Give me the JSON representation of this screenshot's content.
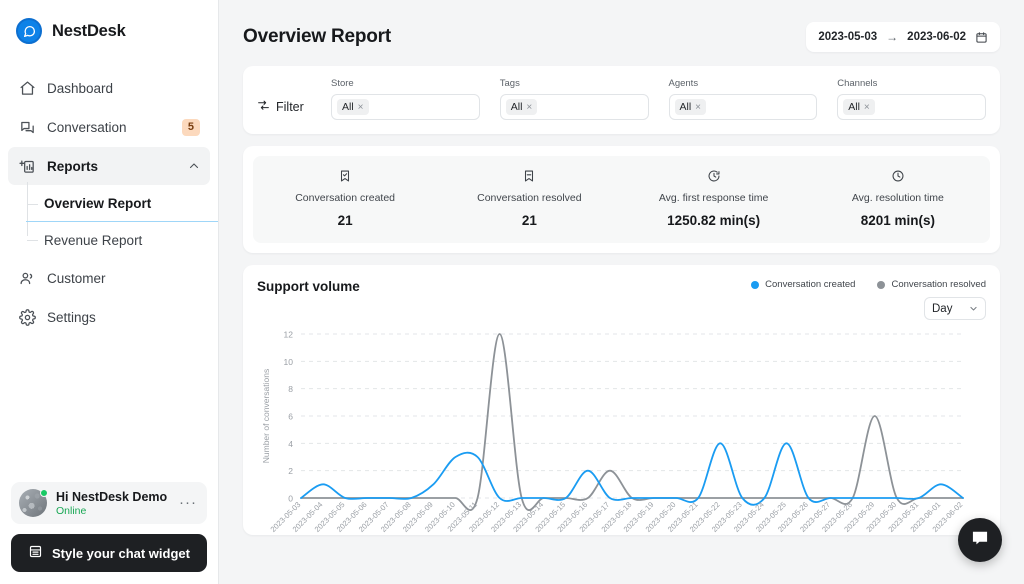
{
  "sidebar": {
    "brand": {
      "name": "NestDesk",
      "logo_icon": "chat-bubble-icon"
    },
    "items": [
      {
        "label": "Dashboard",
        "icon": "home-icon"
      },
      {
        "label": "Conversation",
        "icon": "conversation-icon",
        "badge": "5"
      },
      {
        "label": "Reports",
        "icon": "reports-icon",
        "active": true,
        "chevron": "chevron-up-icon"
      },
      {
        "label": "Customer",
        "icon": "customer-icon"
      },
      {
        "label": "Settings",
        "icon": "gear-icon"
      }
    ],
    "subitems": [
      {
        "label": "Overview Report",
        "selected": true
      },
      {
        "label": "Revenue Report",
        "selected": false
      }
    ],
    "user": {
      "name": "Hi NestDesk Demo",
      "status": "Online",
      "more": "···"
    },
    "widget_button": {
      "label": "Style your chat widget",
      "icon": "layout-icon"
    }
  },
  "header": {
    "title": "Overview Report",
    "date_range": {
      "start": "2023-05-03",
      "arrow": "→",
      "end": "2023-06-02",
      "icon": "calendar-icon"
    }
  },
  "filter": {
    "label": "Filter",
    "icon": "filter-icon",
    "fields": [
      {
        "caption": "Store",
        "value": "All",
        "remove": "×"
      },
      {
        "caption": "Tags",
        "value": "All",
        "remove": "×"
      },
      {
        "caption": "Agents",
        "value": "All",
        "remove": "×"
      },
      {
        "caption": "Channels",
        "value": "All",
        "remove": "×"
      }
    ]
  },
  "stats": [
    {
      "icon": "bookmark-check-icon",
      "label": "Conversation created",
      "value": "21"
    },
    {
      "icon": "bookmark-icon",
      "label": "Conversation resolved",
      "value": "21"
    },
    {
      "icon": "clock-arrow-icon",
      "label": "Avg. first response time",
      "value": "1250.82 min(s)"
    },
    {
      "icon": "clock-icon",
      "label": "Avg. resolution time",
      "value": "8201 min(s)"
    }
  ],
  "chart_panel": {
    "title": "Support volume",
    "granularity": {
      "value": "Day",
      "icon": "chevron-down-icon"
    }
  },
  "colors": {
    "created": "#1a9cf2",
    "resolved": "#8d9297",
    "accent": "#0d82e8",
    "badge_bg": "#fcd9bd",
    "online": "#18a754"
  },
  "chart_data": {
    "type": "line",
    "title": "Support volume",
    "xlabel": "",
    "ylabel": "Number of conversations",
    "ylim": [
      0,
      12
    ],
    "yticks": [
      0,
      2,
      4,
      6,
      8,
      10,
      12
    ],
    "grid": true,
    "legend_position": "top-right",
    "x": [
      "2023-05-03",
      "2023-05-04",
      "2023-05-05",
      "2023-05-06",
      "2023-05-07",
      "2023-05-08",
      "2023-05-09",
      "2023-05-10",
      "2023-05-11",
      "2023-05-12",
      "2023-05-13",
      "2023-05-14",
      "2023-05-15",
      "2023-05-16",
      "2023-05-17",
      "2023-05-18",
      "2023-05-19",
      "2023-05-20",
      "2023-05-21",
      "2023-05-22",
      "2023-05-23",
      "2023-05-24",
      "2023-05-25",
      "2023-05-26",
      "2023-05-27",
      "2023-05-28",
      "2023-05-29",
      "2023-05-30",
      "2023-05-31",
      "2023-06-01",
      "2023-06-02"
    ],
    "series": [
      {
        "name": "Conversation created",
        "color": "#1a9cf2",
        "values": [
          0,
          1,
          0,
          0,
          0,
          0,
          1,
          3,
          3,
          0,
          0,
          0,
          0,
          2,
          0,
          0,
          0,
          0,
          0,
          4,
          0,
          0,
          4,
          0,
          0,
          0,
          0,
          0,
          0,
          1,
          0
        ]
      },
      {
        "name": "Conversation resolved",
        "color": "#8d9297",
        "values": [
          0,
          0,
          0,
          0,
          0,
          0,
          0,
          0,
          0,
          12,
          0,
          0,
          0,
          0,
          2,
          0,
          0,
          0,
          0,
          0,
          0,
          0,
          0,
          0,
          0,
          0,
          6,
          0,
          0,
          0,
          0
        ]
      }
    ]
  },
  "chat_fab": {
    "icon": "chat-bubble-icon"
  }
}
